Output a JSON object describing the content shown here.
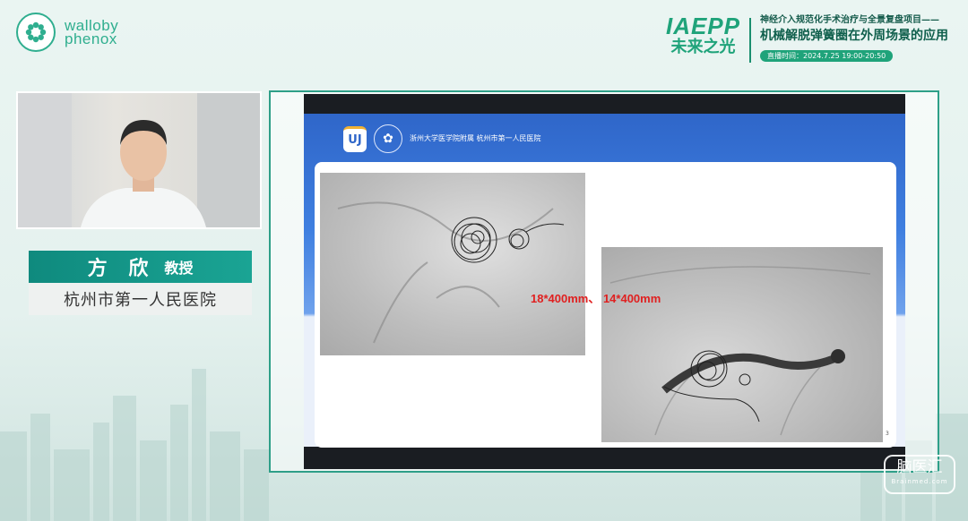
{
  "brand": {
    "line1": "walloby",
    "line2": "phenox",
    "icon": "flower-logo-icon",
    "color": "#2fae8f"
  },
  "event": {
    "logo_main": "IAEPP",
    "logo_sub": "未来之光",
    "line1": "神经介入规范化手术治疗与全景复盘项目——",
    "line2": "机械解脱弹簧圈在外周场景的应用",
    "time": "直播时间：2024.7.25 19:00-20:50",
    "accent": "#1fa37a"
  },
  "presenter": {
    "name": "方 欣",
    "title": "教授",
    "hospital": "杭州市第一人民医院",
    "bar_color": "#0f8a7e"
  },
  "slide": {
    "logo_badge": "UJ",
    "hospital_header_cn": "浙州大学医学院附属 杭州市第一人民医院",
    "annotation": "18*400mm、 14*400mm",
    "annotation_color": "#e02020",
    "page": "3",
    "header_color": "#2f66c9"
  },
  "watermark": {
    "main": "脑医汇",
    "sub": "Brainmed.com"
  }
}
